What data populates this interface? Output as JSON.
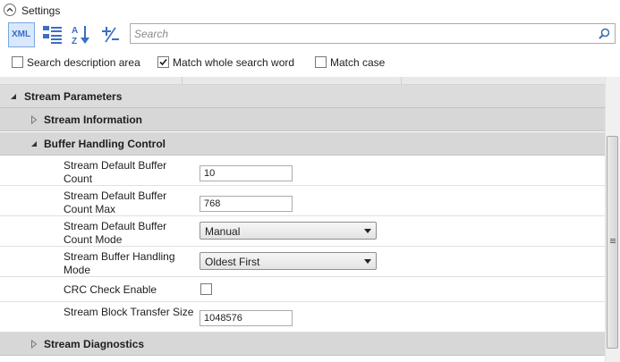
{
  "header": {
    "title": "Settings"
  },
  "toolbar": {
    "xml_label": "XML"
  },
  "search": {
    "placeholder": "Search"
  },
  "options": {
    "search_description": {
      "label": "Search description area",
      "checked": false
    },
    "match_whole_word": {
      "label": "Match whole search word",
      "checked": true
    },
    "match_case": {
      "label": "Match case",
      "checked": false
    }
  },
  "tree": {
    "root": {
      "label": "Stream Parameters",
      "expanded": true
    },
    "stream_information": {
      "label": "Stream Information",
      "expanded": false
    },
    "buffer_handling": {
      "label": "Buffer Handling Control",
      "expanded": true
    },
    "stream_diagnostics": {
      "label": "Stream Diagnostics",
      "expanded": false
    }
  },
  "properties": [
    {
      "name": "Stream Default Buffer Count",
      "value": "10"
    },
    {
      "name": "Stream Default Buffer Count Max",
      "value": "768"
    },
    {
      "name": "Stream Default Buffer Count Mode",
      "value": "Manual"
    },
    {
      "name": "Stream Buffer Handling Mode",
      "value": "Oldest First"
    },
    {
      "name": "CRC Check Enable",
      "checked": false
    },
    {
      "name": "Stream Block Transfer Size",
      "value": "1048576"
    }
  ],
  "colors": {
    "category_bg": "#d7d7d7",
    "accent": "#79a7e0",
    "check": "#1e1e1e"
  }
}
